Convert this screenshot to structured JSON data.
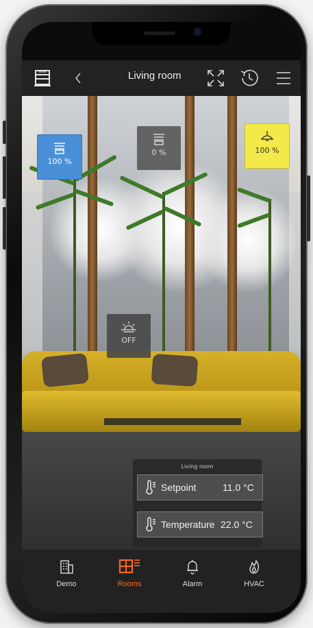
{
  "header": {
    "title": "Living room",
    "icons": [
      "building-menu-icon",
      "back-chevron-icon",
      "expand-icon",
      "history-clock-icon",
      "hamburger-menu-icon"
    ]
  },
  "tiles": {
    "blind_left": {
      "value": "100 %",
      "icon": "blind-icon",
      "color": "#4a90d9"
    },
    "blind_center": {
      "value": "0 %",
      "icon": "blind-icon"
    },
    "ceiling_light": {
      "value": "100 %",
      "icon": "ceiling-lamp-icon",
      "color": "#f3e94a"
    },
    "sunrise_scene": {
      "value": "OFF",
      "icon": "sunrise-icon"
    }
  },
  "climate": {
    "title": "Living room",
    "rows": [
      {
        "label": "Setpoint",
        "value": "11.0 °C",
        "icon": "thermometer-icon"
      },
      {
        "label": "Temperature",
        "value": "22.0 °C",
        "icon": "thermometer-icon"
      }
    ]
  },
  "tabs": [
    {
      "label": "Demo",
      "icon": "building-icon",
      "active": false
    },
    {
      "label": "Rooms",
      "icon": "floorplan-icon",
      "active": true
    },
    {
      "label": "Alarm",
      "icon": "bell-icon",
      "active": false
    },
    {
      "label": "HVAC",
      "icon": "flame-icon",
      "active": false
    }
  ],
  "colors": {
    "accent": "#ff6a1a",
    "bar": "#222222"
  }
}
